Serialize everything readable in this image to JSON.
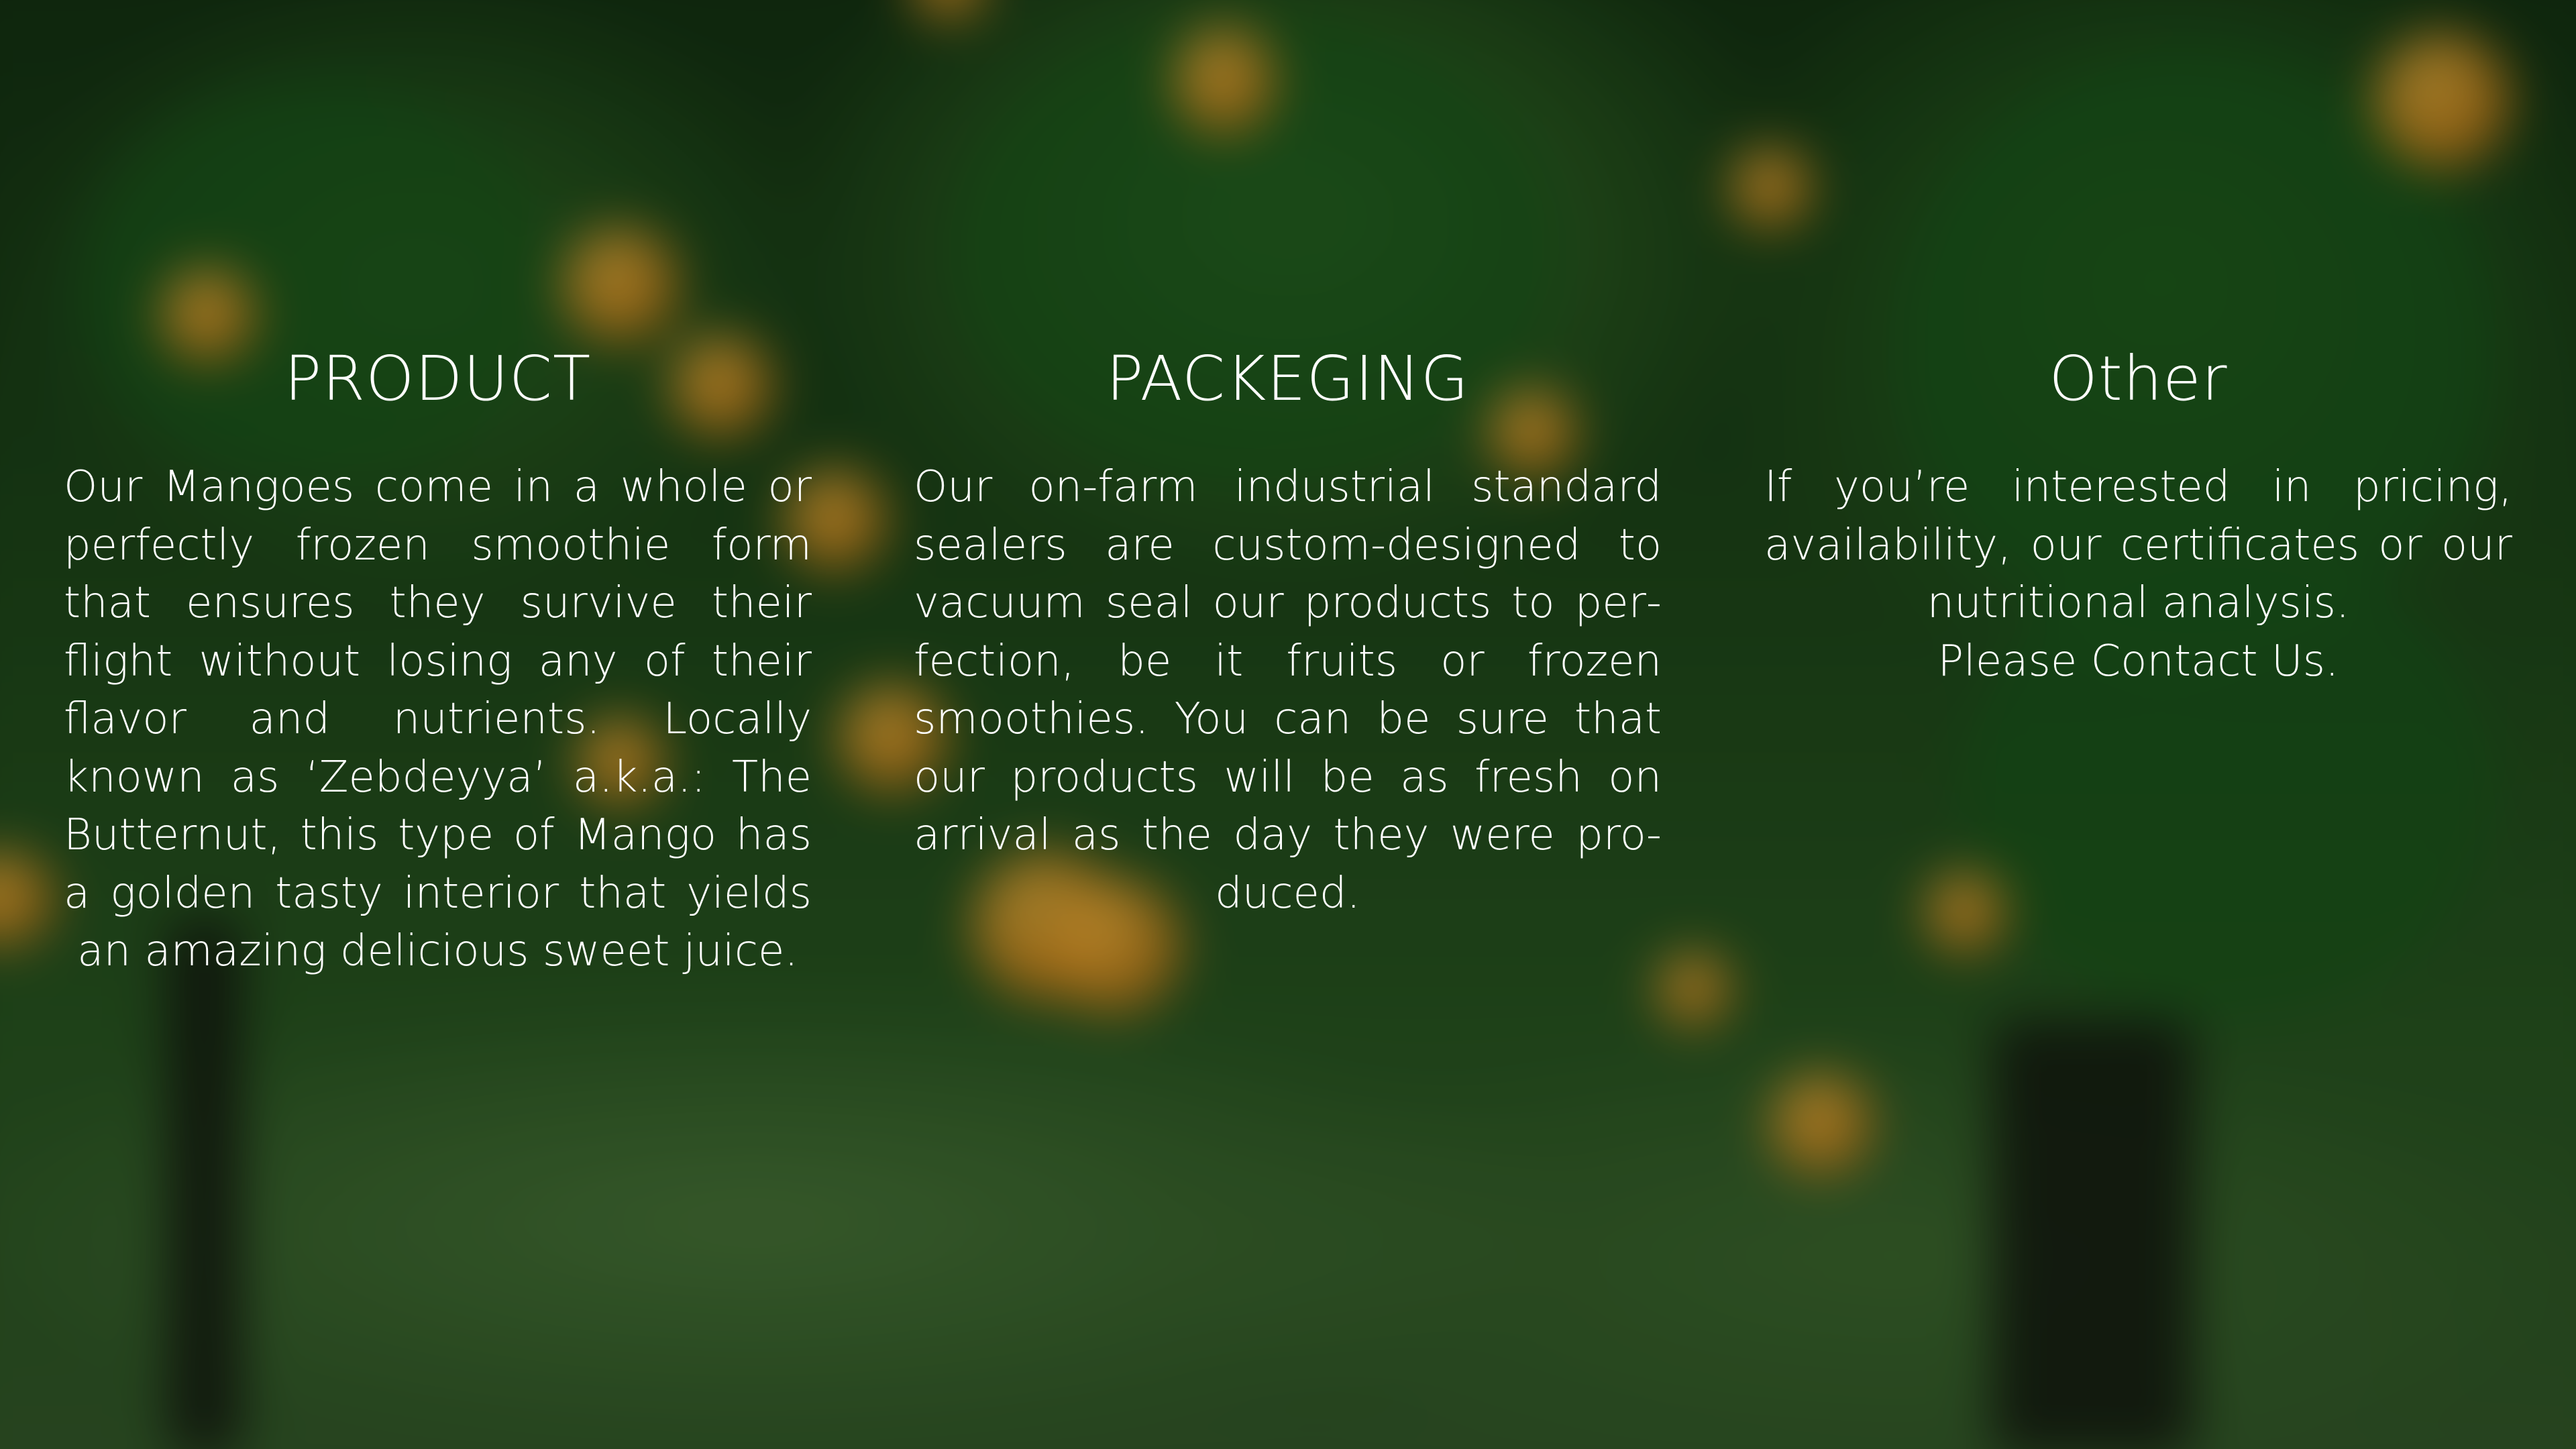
{
  "sections": [
    {
      "title": "PRODUCT",
      "body": "Our Mangoes come in a whole or perfectly frozen smoothie form that ensures they survive their flight without losing any of their flavor and nutrients. Locally known as ‘Zebdeyya’ a.k.a.: The Butternut, this type of Mango has a golden tasty interior that yields an amazing delicious sweet juice."
    },
    {
      "title": "PACKEGING",
      "body": "Our on-farm industrial standard sealers are custom-designed to vacuum seal our products to per­fection, be it fruits or frozen smoothies. You can be sure that our products will be as fresh on arrival as the day they were pro­duced."
    },
    {
      "title": "Other",
      "body": "If you’re interested in pricing, availability, our certificates or our nutritional analysis.",
      "contact": "Please Contact Us."
    }
  ],
  "colors": {
    "text": "#ffffff",
    "foliage": "#2f6a24",
    "fruit": "#e8921b"
  }
}
